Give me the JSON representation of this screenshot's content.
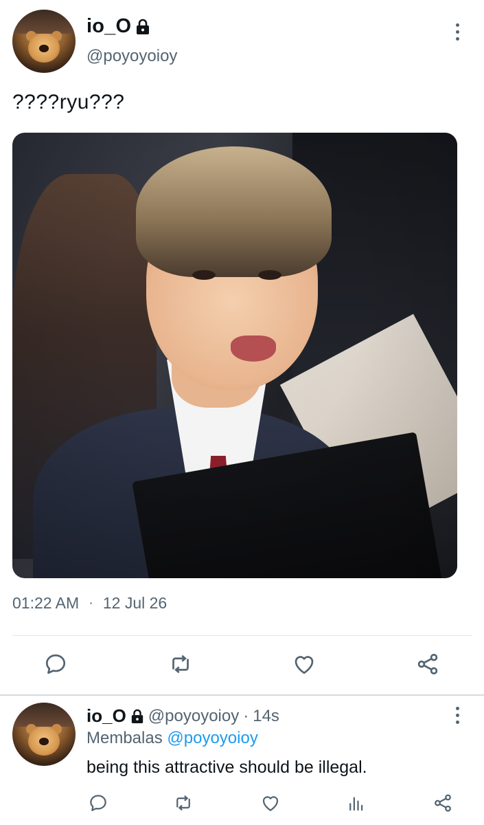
{
  "tweet": {
    "display_name": "io_O",
    "handle": "@poyoyoioy",
    "text": "????ryu???",
    "time": "01:22 AM",
    "separator": "·",
    "date": "12 Jul 26",
    "avatar_icon": "teddy-bear-avatar",
    "lock_icon": "lock-icon",
    "actions": [
      "reply-icon",
      "retweet-icon",
      "like-icon",
      "share-icon"
    ]
  },
  "reply": {
    "display_name": "io_O",
    "handle": "@poyoyoioy",
    "time_sep": "·",
    "time": "14s",
    "replying_prefix": "Membalas",
    "replying_mention": "@poyoyoioy",
    "text": "being this attractive should be illegal.",
    "actions": [
      "reply-icon",
      "retweet-icon",
      "like-icon",
      "analytics-icon",
      "share-icon"
    ]
  },
  "colors": {
    "primary_text": "#0f1419",
    "secondary_text": "#536471",
    "accent": "#1d9bf0",
    "divider": "#e1e6ea"
  }
}
